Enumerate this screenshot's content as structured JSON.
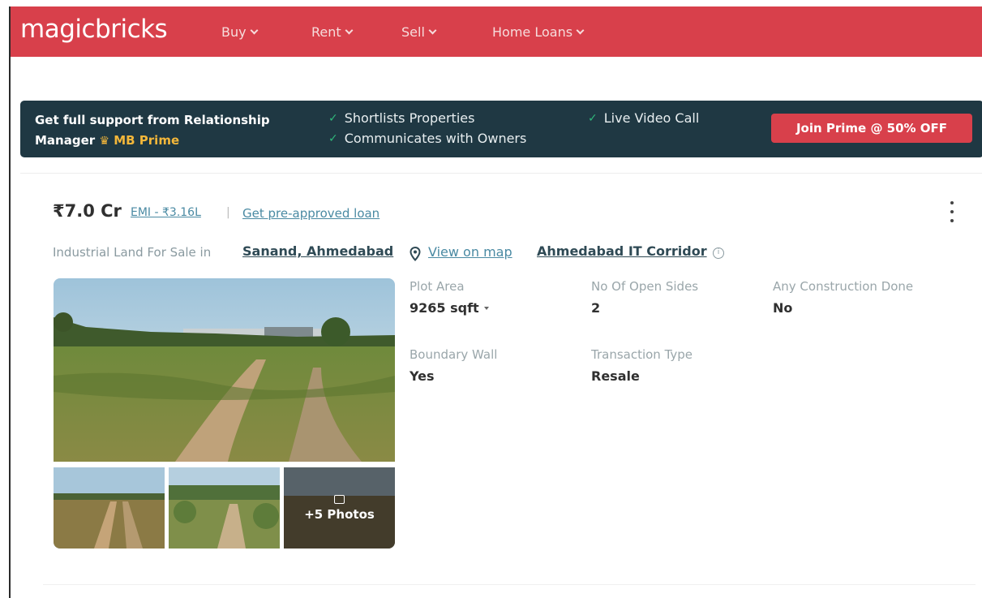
{
  "header": {
    "logo": "magicbricks",
    "nav": [
      {
        "label": "Buy"
      },
      {
        "label": "Rent"
      },
      {
        "label": "Sell"
      },
      {
        "label": "Home Loans"
      }
    ],
    "background": "#d8404b"
  },
  "banner": {
    "title_line1": "Get full support from Relationship",
    "title_line2": "Manager",
    "prime_label": "MB Prime",
    "features": [
      "Shortlists Properties",
      "Communicates with Owners",
      "Live Video Call"
    ],
    "cta": "Join Prime @ 50% OFF",
    "background": "#1f3843",
    "accent": "#f4b73a"
  },
  "listing": {
    "price": "₹7.0 Cr",
    "emi": "EMI - ₹3.16L",
    "separator": "|",
    "loan_link": "Get pre-approved loan",
    "subtitle": "Industrial Land For Sale in",
    "locality": "Sanand, Ahmedabad",
    "view_on_map": "View on map",
    "corridor": "Ahmedabad IT Corridor",
    "info_glyph": "i",
    "more_photos": "+5 Photos",
    "specs": [
      {
        "label": "Plot Area",
        "value": "9265 sqft"
      },
      {
        "label": "No Of Open Sides",
        "value": "2"
      },
      {
        "label": "Any Construction Done",
        "value": "No"
      },
      {
        "label": "Boundary Wall",
        "value": "Yes"
      },
      {
        "label": "Transaction Type",
        "value": "Resale"
      }
    ]
  },
  "colors": {
    "link": "#4a8aa3",
    "check": "#2fb87a",
    "cta": "#d8404b"
  }
}
